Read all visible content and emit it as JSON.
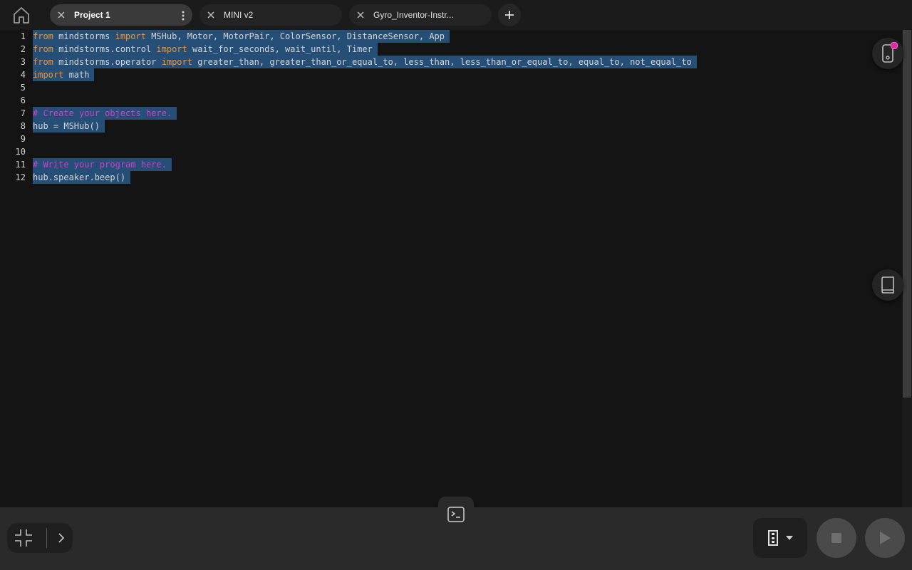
{
  "tabs": [
    {
      "label": "Project 1",
      "active": true
    },
    {
      "label": "MINI v2",
      "active": false
    },
    {
      "label": "Gyro_Inventor-Instr...",
      "active": false
    }
  ],
  "editor": {
    "lines": [
      {
        "num": "1",
        "tokens": [
          {
            "t": "from",
            "c": "kw"
          },
          {
            "t": " mindstorms "
          },
          {
            "t": "import",
            "c": "kw"
          },
          {
            "t": " MSHub, Motor, MotorPair, ColorSensor, DistanceSensor, App"
          }
        ]
      },
      {
        "num": "2",
        "tokens": [
          {
            "t": "from",
            "c": "kw"
          },
          {
            "t": " mindstorms.control "
          },
          {
            "t": "import",
            "c": "kw"
          },
          {
            "t": " wait_for_seconds, wait_until, Timer"
          }
        ]
      },
      {
        "num": "3",
        "tokens": [
          {
            "t": "from",
            "c": "kw"
          },
          {
            "t": " mindstorms.operator "
          },
          {
            "t": "import",
            "c": "kw"
          },
          {
            "t": " greater_than, greater_than_or_equal_to, less_than, less_than_or_equal_to, equal_to, not_equal_to"
          }
        ]
      },
      {
        "num": "4",
        "tokens": [
          {
            "t": "import",
            "c": "kw"
          },
          {
            "t": " math"
          }
        ]
      },
      {
        "num": "5",
        "tokens": []
      },
      {
        "num": "6",
        "tokens": []
      },
      {
        "num": "7",
        "tokens": [
          {
            "t": "# Create your objects here.",
            "c": "cm"
          }
        ]
      },
      {
        "num": "8",
        "tokens": [
          {
            "t": "hub = MSHub()"
          }
        ]
      },
      {
        "num": "9",
        "tokens": []
      },
      {
        "num": "10",
        "tokens": []
      },
      {
        "num": "11",
        "tokens": [
          {
            "t": "# Write your program here.",
            "c": "cm"
          }
        ]
      },
      {
        "num": "12",
        "tokens": [
          {
            "t": "hub.speaker.beep()"
          }
        ]
      }
    ],
    "selection_color": "#264f78",
    "keyword_color": "#e59544",
    "comment_color": "#c046c8"
  },
  "icons": {
    "home": "home-icon",
    "close": "close-icon",
    "more": "more-vertical-icon",
    "add": "plus-icon",
    "hub": "hub-connection-icon",
    "knowledge_base": "book-icon",
    "console": "terminal-icon",
    "shrink": "shrink-icon",
    "expand": "chevron-right-icon",
    "slot": "program-slot-icon",
    "stop": "stop-icon",
    "play": "play-icon"
  },
  "status": {
    "hub_indicator_color": "#d92ba5"
  }
}
